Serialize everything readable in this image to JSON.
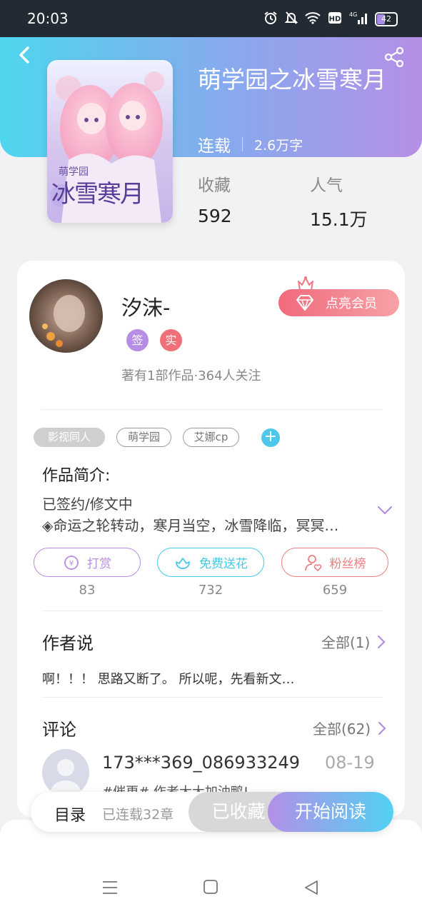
{
  "status_bar": {
    "time": "20:03",
    "battery": "42",
    "icons": [
      "alarm-icon",
      "mute-icon",
      "wifi-icon",
      "hd-icon",
      "signal-4g-icon",
      "battery-icon"
    ]
  },
  "header": {
    "title": "萌学园之冰雪寒月",
    "status": "连载",
    "word_count": "2.6万字",
    "stats": [
      {
        "label": "收藏",
        "value": "592"
      },
      {
        "label": "人气",
        "value": "15.1万"
      }
    ],
    "cover_text": "冰雪寒月",
    "cover_subtitle": "萌学园"
  },
  "author": {
    "name": "汐沫-",
    "badges": [
      {
        "label": "签",
        "color": "#b78ee3"
      },
      {
        "label": "实",
        "color": "#f0707a"
      }
    ],
    "follow_info": "著有1部作品·364人关注",
    "vip_button": "点亮会员"
  },
  "tags": [
    "影视同人",
    "萌学园",
    "艾娜cp"
  ],
  "intro": {
    "title": "作品简介:",
    "lines": [
      "已签约/修文中",
      "◈命运之轮转动，寒月当空，冰雪降临，冥冥…"
    ]
  },
  "actions": [
    {
      "label": "打赏",
      "count": "83",
      "color": "#b98de0",
      "icon": "reward-icon"
    },
    {
      "label": "免费送花",
      "count": "732",
      "color": "#45c9e6",
      "icon": "flower-icon"
    },
    {
      "label": "粉丝榜",
      "count": "659",
      "color": "#ec7f80",
      "icon": "fans-icon"
    }
  ],
  "author_says": {
    "title": "作者说",
    "more": "全部(1)",
    "text": "啊！！！ 思路又断了。 所以呢，先看新文…"
  },
  "comments": {
    "title": "评论",
    "more": "全部(62)",
    "items": [
      {
        "user": "173***369_086933249",
        "date": "08-19",
        "text": "#催更# 作者大大加油鸭!"
      }
    ]
  },
  "bottom_bar": {
    "toc": "目录",
    "chapters": "已连载32章",
    "collected": "已收藏",
    "read": "开始阅读"
  },
  "colors": {
    "accent_cyan": "#4fd6ee",
    "accent_purple": "#b58fe6",
    "vip_red": "#f06a7c"
  }
}
